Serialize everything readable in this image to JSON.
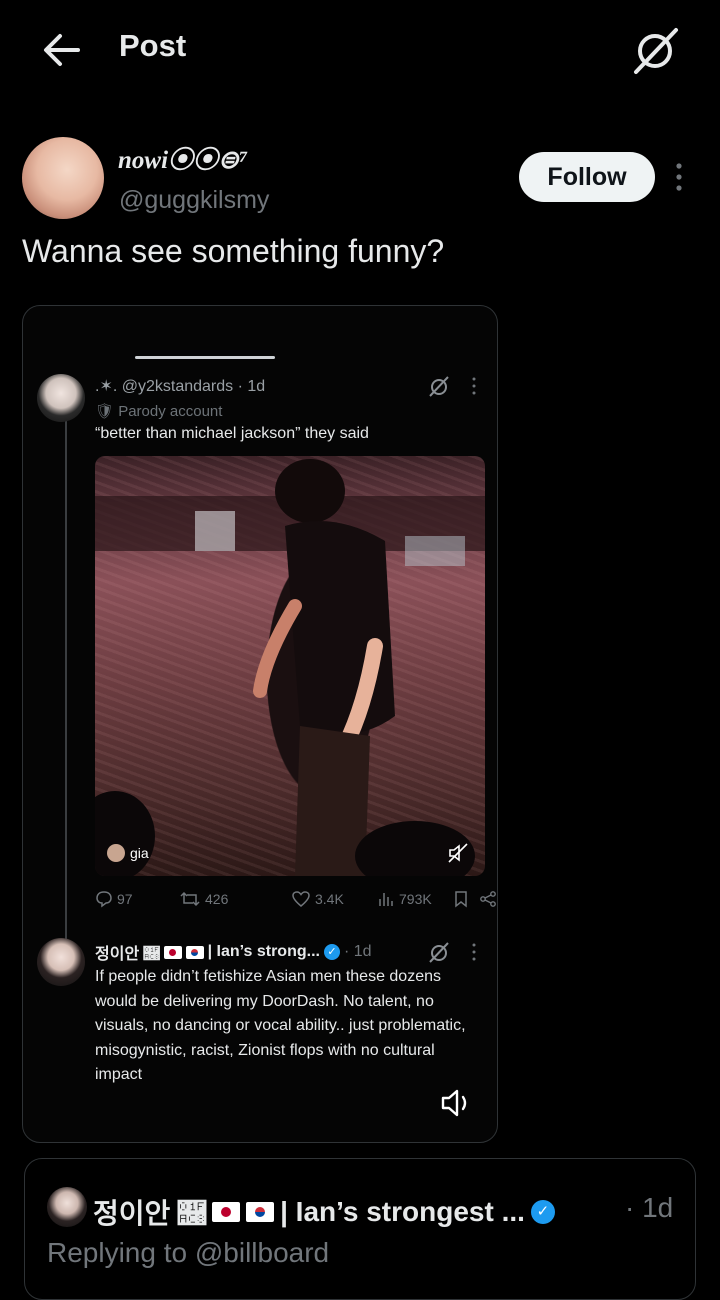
{
  "header": {
    "title": "Post",
    "back_icon": "arrow-left-icon",
    "grok_icon": "grok-icon"
  },
  "post": {
    "author_name": "nowi⦿⦿⊜⁷",
    "author_handle": "@guggkilsmy",
    "follow_label": "Follow",
    "text": "Wanna see something funny?"
  },
  "embedded": {
    "tweet1": {
      "header": ".✶. @y2kstandards · 1d",
      "sub": "🛡 Parody account",
      "text": "“better than michael jackson” they said"
    },
    "video_label": "gia",
    "stats": {
      "replies": "97",
      "reposts": "426",
      "likes": "3.4K",
      "views": "793K"
    },
    "tweet2": {
      "name": "정이안 🫈",
      "name_tail": "| Ian’s strong...",
      "time": "· 1d",
      "text": "If people didn’t fetishize Asian men these dozens would be delivering my DoorDash. No talent, no visuals, no dancing or vocal ability.. just problematic, misogynistic, racist, Zionist flops with no cultural impact"
    }
  },
  "reply": {
    "name": "정이안 🫈",
    "name_tail": "| Ian’s strongest ...",
    "time": "· 1d",
    "replying_to": "Replying to @billboard"
  },
  "colors": {
    "background": "#000000",
    "text": "#e7e9ea",
    "muted": "#71767b",
    "verified": "#1d9bf0",
    "follow_bg": "#eff3f4"
  }
}
